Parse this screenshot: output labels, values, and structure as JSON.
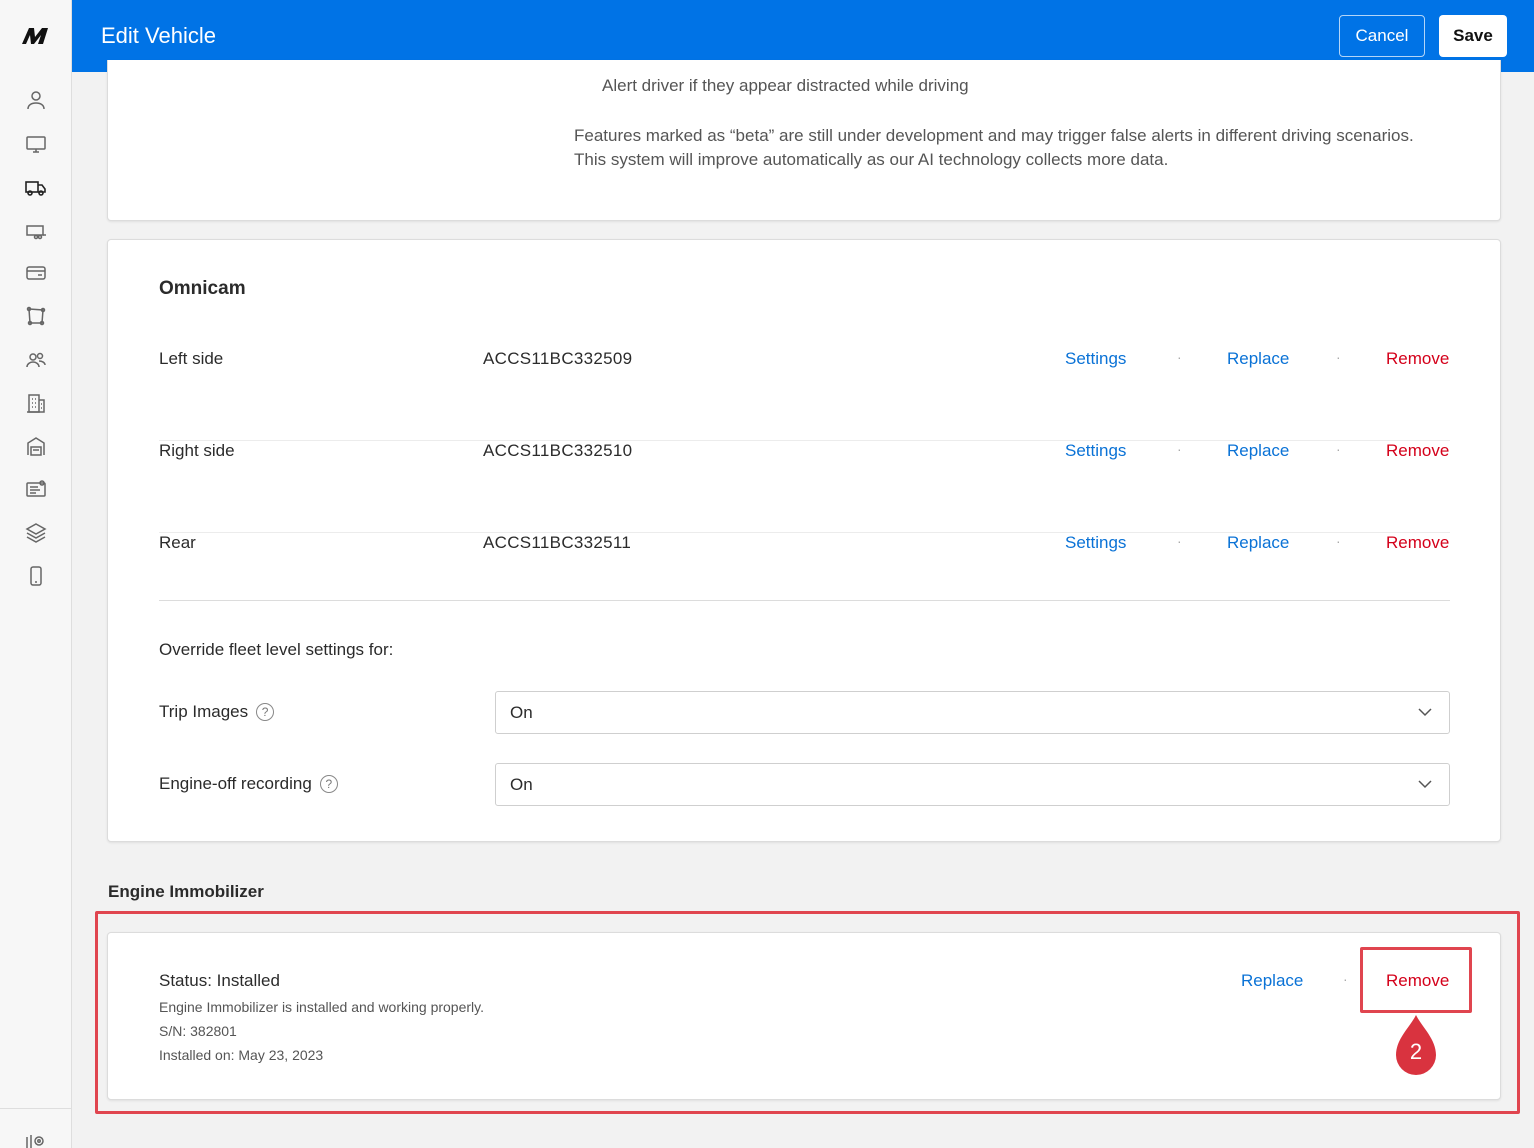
{
  "header": {
    "title": "Edit Vehicle",
    "cancel_label": "Cancel",
    "save_label": "Save",
    "brand_color": "#0073e6"
  },
  "sidebar": {
    "logo": "M",
    "items": [
      {
        "icon": "user-icon"
      },
      {
        "icon": "monitor-icon"
      },
      {
        "icon": "truck-icon",
        "active": true
      },
      {
        "icon": "trailer-icon"
      },
      {
        "icon": "card-icon"
      },
      {
        "icon": "geofence-icon"
      },
      {
        "icon": "users-icon"
      },
      {
        "icon": "building-icon"
      },
      {
        "icon": "garage-icon"
      },
      {
        "icon": "report-icon"
      },
      {
        "icon": "layers-icon"
      },
      {
        "icon": "phone-icon"
      }
    ],
    "bottom_icon": "map-pin-icon"
  },
  "top_section": {
    "alert_text": "Alert driver if they appear distracted while driving",
    "beta_note_line1": "Features marked as “beta” are still under development and may trigger false alerts in different driving scenarios.",
    "beta_note_line2": "This system will improve automatically as our AI technology collects more data."
  },
  "omnicam": {
    "title": "Omnicam",
    "cameras": [
      {
        "label": "Left side",
        "serial": "ACCS11BC332509",
        "settings": "Settings",
        "replace": "Replace",
        "remove": "Remove"
      },
      {
        "label": "Right side",
        "serial": "ACCS11BC332510",
        "settings": "Settings",
        "replace": "Replace",
        "remove": "Remove"
      },
      {
        "label": "Rear",
        "serial": "ACCS11BC332511",
        "settings": "Settings",
        "replace": "Replace",
        "remove": "Remove"
      }
    ],
    "separator": "·",
    "override_label": "Override fleet level settings for:",
    "settings": [
      {
        "label": "Trip Images",
        "value": "On"
      },
      {
        "label": "Engine-off recording",
        "value": "On"
      }
    ]
  },
  "engine_immobilizer": {
    "heading": "Engine Immobilizer",
    "status": "Status: Installed",
    "description": "Engine Immobilizer is installed and working properly.",
    "serial": "S/N: 382801",
    "installed_on": "Installed on: May 23, 2023",
    "replace": "Replace",
    "remove": "Remove",
    "separator": "·"
  },
  "annotation": {
    "step_number": "2",
    "color": "#e0454f"
  }
}
